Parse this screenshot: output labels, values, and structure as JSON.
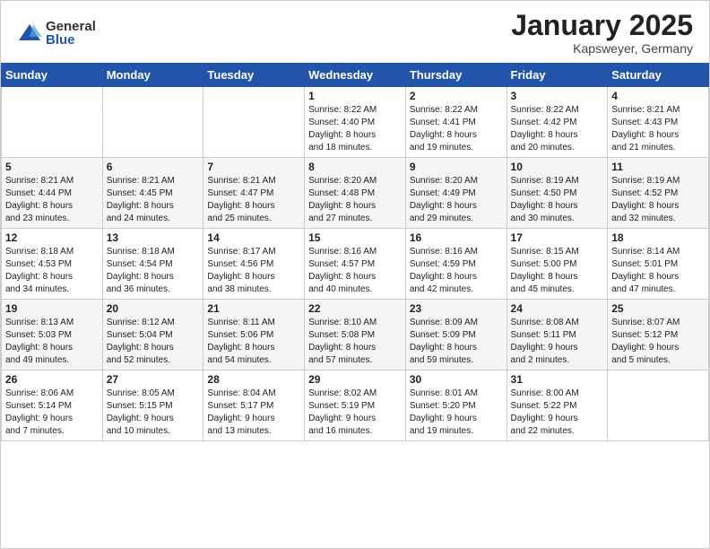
{
  "logo": {
    "general": "General",
    "blue": "Blue"
  },
  "header": {
    "month": "January 2025",
    "location": "Kapsweyer, Germany"
  },
  "weekdays": [
    "Sunday",
    "Monday",
    "Tuesday",
    "Wednesday",
    "Thursday",
    "Friday",
    "Saturday"
  ],
  "weeks": [
    [
      {
        "day": "",
        "info": ""
      },
      {
        "day": "",
        "info": ""
      },
      {
        "day": "",
        "info": ""
      },
      {
        "day": "1",
        "info": "Sunrise: 8:22 AM\nSunset: 4:40 PM\nDaylight: 8 hours\nand 18 minutes."
      },
      {
        "day": "2",
        "info": "Sunrise: 8:22 AM\nSunset: 4:41 PM\nDaylight: 8 hours\nand 19 minutes."
      },
      {
        "day": "3",
        "info": "Sunrise: 8:22 AM\nSunset: 4:42 PM\nDaylight: 8 hours\nand 20 minutes."
      },
      {
        "day": "4",
        "info": "Sunrise: 8:21 AM\nSunset: 4:43 PM\nDaylight: 8 hours\nand 21 minutes."
      }
    ],
    [
      {
        "day": "5",
        "info": "Sunrise: 8:21 AM\nSunset: 4:44 PM\nDaylight: 8 hours\nand 23 minutes."
      },
      {
        "day": "6",
        "info": "Sunrise: 8:21 AM\nSunset: 4:45 PM\nDaylight: 8 hours\nand 24 minutes."
      },
      {
        "day": "7",
        "info": "Sunrise: 8:21 AM\nSunset: 4:47 PM\nDaylight: 8 hours\nand 25 minutes."
      },
      {
        "day": "8",
        "info": "Sunrise: 8:20 AM\nSunset: 4:48 PM\nDaylight: 8 hours\nand 27 minutes."
      },
      {
        "day": "9",
        "info": "Sunrise: 8:20 AM\nSunset: 4:49 PM\nDaylight: 8 hours\nand 29 minutes."
      },
      {
        "day": "10",
        "info": "Sunrise: 8:19 AM\nSunset: 4:50 PM\nDaylight: 8 hours\nand 30 minutes."
      },
      {
        "day": "11",
        "info": "Sunrise: 8:19 AM\nSunset: 4:52 PM\nDaylight: 8 hours\nand 32 minutes."
      }
    ],
    [
      {
        "day": "12",
        "info": "Sunrise: 8:18 AM\nSunset: 4:53 PM\nDaylight: 8 hours\nand 34 minutes."
      },
      {
        "day": "13",
        "info": "Sunrise: 8:18 AM\nSunset: 4:54 PM\nDaylight: 8 hours\nand 36 minutes."
      },
      {
        "day": "14",
        "info": "Sunrise: 8:17 AM\nSunset: 4:56 PM\nDaylight: 8 hours\nand 38 minutes."
      },
      {
        "day": "15",
        "info": "Sunrise: 8:16 AM\nSunset: 4:57 PM\nDaylight: 8 hours\nand 40 minutes."
      },
      {
        "day": "16",
        "info": "Sunrise: 8:16 AM\nSunset: 4:59 PM\nDaylight: 8 hours\nand 42 minutes."
      },
      {
        "day": "17",
        "info": "Sunrise: 8:15 AM\nSunset: 5:00 PM\nDaylight: 8 hours\nand 45 minutes."
      },
      {
        "day": "18",
        "info": "Sunrise: 8:14 AM\nSunset: 5:01 PM\nDaylight: 8 hours\nand 47 minutes."
      }
    ],
    [
      {
        "day": "19",
        "info": "Sunrise: 8:13 AM\nSunset: 5:03 PM\nDaylight: 8 hours\nand 49 minutes."
      },
      {
        "day": "20",
        "info": "Sunrise: 8:12 AM\nSunset: 5:04 PM\nDaylight: 8 hours\nand 52 minutes."
      },
      {
        "day": "21",
        "info": "Sunrise: 8:11 AM\nSunset: 5:06 PM\nDaylight: 8 hours\nand 54 minutes."
      },
      {
        "day": "22",
        "info": "Sunrise: 8:10 AM\nSunset: 5:08 PM\nDaylight: 8 hours\nand 57 minutes."
      },
      {
        "day": "23",
        "info": "Sunrise: 8:09 AM\nSunset: 5:09 PM\nDaylight: 8 hours\nand 59 minutes."
      },
      {
        "day": "24",
        "info": "Sunrise: 8:08 AM\nSunset: 5:11 PM\nDaylight: 9 hours\nand 2 minutes."
      },
      {
        "day": "25",
        "info": "Sunrise: 8:07 AM\nSunset: 5:12 PM\nDaylight: 9 hours\nand 5 minutes."
      }
    ],
    [
      {
        "day": "26",
        "info": "Sunrise: 8:06 AM\nSunset: 5:14 PM\nDaylight: 9 hours\nand 7 minutes."
      },
      {
        "day": "27",
        "info": "Sunrise: 8:05 AM\nSunset: 5:15 PM\nDaylight: 9 hours\nand 10 minutes."
      },
      {
        "day": "28",
        "info": "Sunrise: 8:04 AM\nSunset: 5:17 PM\nDaylight: 9 hours\nand 13 minutes."
      },
      {
        "day": "29",
        "info": "Sunrise: 8:02 AM\nSunset: 5:19 PM\nDaylight: 9 hours\nand 16 minutes."
      },
      {
        "day": "30",
        "info": "Sunrise: 8:01 AM\nSunset: 5:20 PM\nDaylight: 9 hours\nand 19 minutes."
      },
      {
        "day": "31",
        "info": "Sunrise: 8:00 AM\nSunset: 5:22 PM\nDaylight: 9 hours\nand 22 minutes."
      },
      {
        "day": "",
        "info": ""
      }
    ]
  ]
}
